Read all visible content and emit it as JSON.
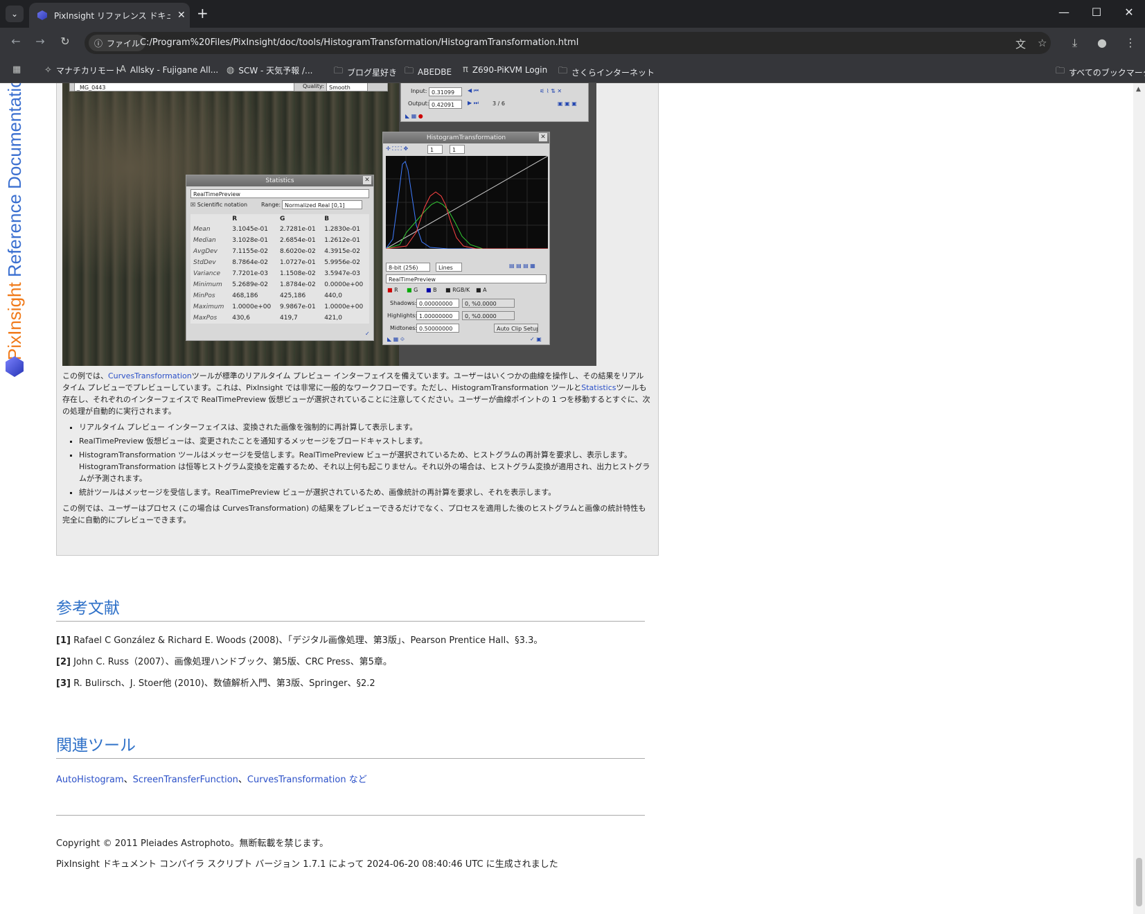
{
  "browser": {
    "tab_title": "PixInsight リファレンス ドキュメント | H",
    "site_info": "ファイル",
    "url": "C:/Program%20Files/PixInsight/doc/tools/HistogramTransformation/HistogramTransformation.html",
    "bookmarks": [
      {
        "icon": "app-icon",
        "label": "マナチカリモート"
      },
      {
        "icon": "as-icon",
        "label": "Allsky - Fujigane All..."
      },
      {
        "icon": "scw-icon",
        "label": "SCW - 天気予報 /..."
      },
      {
        "icon": "folder-icon",
        "label": "ブログ星好き"
      },
      {
        "icon": "folder-icon",
        "label": "ABEDBE"
      },
      {
        "icon": "pi-icon",
        "label": "Z690-PiKVM Login"
      },
      {
        "icon": "folder-icon",
        "label": "さくらインターネット"
      }
    ],
    "all_bookmarks": "すべてのブックマーク"
  },
  "side_banner": {
    "brand": "PixInsight",
    "docs": " Reference Documentation"
  },
  "screenshot": {
    "top_bar": {
      "image": "_MG_0443",
      "quality_label": "Quality:",
      "quality_value": "Smooth"
    },
    "curves": {
      "input_label": "Input:",
      "input_value": "0.31099",
      "output_label": "Output:",
      "output_value": "0.42091",
      "count": "3 / 6"
    },
    "stats": {
      "title": "Statistics",
      "view": "RealTimePreview",
      "sci": "Scientific notation",
      "range_label": "Range:",
      "range_value": "Normalized Real [0,1]",
      "headers": [
        "",
        "R",
        "G",
        "B"
      ],
      "rows": [
        [
          "Mean",
          "3.1045e-01",
          "2.7281e-01",
          "1.2830e-01"
        ],
        [
          "Median",
          "3.1028e-01",
          "2.6854e-01",
          "1.2612e-01"
        ],
        [
          "AvgDev",
          "7.1155e-02",
          "8.6020e-02",
          "4.3915e-02"
        ],
        [
          "StdDev",
          "8.7864e-02",
          "1.0727e-01",
          "5.9956e-02"
        ],
        [
          "Variance",
          "7.7201e-03",
          "1.1508e-02",
          "3.5947e-03"
        ],
        [
          "Minimum",
          "5.2689e-02",
          "1.8784e-02",
          "0.0000e+00"
        ],
        [
          "MinPos",
          "468,186",
          "425,186",
          "440,0"
        ],
        [
          "Maximum",
          "1.0000e+00",
          "9.9867e-01",
          "1.0000e+00"
        ],
        [
          "MaxPos",
          "430,6",
          "419,7",
          "421,0"
        ]
      ]
    },
    "hist": {
      "title": "HistogramTransformation",
      "bits": "8-bit (256)",
      "mode": "Lines",
      "view": "RealTimePreview",
      "channels": [
        "R",
        "G",
        "B",
        "RGB/K",
        "A"
      ],
      "shadows_label": "Shadows:",
      "shadows_value": "0.00000000",
      "shadows_stat": "0, %0.0000",
      "highlights_label": "Highlights:",
      "highlights_value": "1.00000000",
      "highlights_stat": "0, %0.0000",
      "midtones_label": "Midtones:",
      "midtones_value": "0.50000000",
      "auto_clip": "Auto Clip Setup",
      "zoom_h": "1",
      "zoom_v": "1"
    }
  },
  "body": {
    "p1_a": "この例では、",
    "p1_link1": "CurvesTransformation",
    "p1_b": "ツールが標準のリアルタイム プレビュー インターフェイスを備えています。ユーザーはいくつかの曲線を操作し、その結果をリアルタイム プレビューでプレビューしています。これは、PixInsight では非常に一般的なワークフローです。ただし、HistogramTransformation ツールと",
    "p1_link2": "Statistics",
    "p1_c": "ツールも存在し、それぞれのインターフェイスで RealTimePreview 仮想ビューが選択されていることに注意してください。ユーザーが曲線ポイントの 1 つを移動するとすぐに、次の処理が自動的に実行されます。",
    "bullets": [
      "リアルタイム プレビュー インターフェイスは、変換された画像を強制的に再計算して表示します。",
      "RealTimePreview 仮想ビューは、変更されたことを通知するメッセージをブロードキャストします。",
      "HistogramTransformation ツールはメッセージを受信します。RealTimePreview ビューが選択されているため、ヒストグラムの再計算を要求し、表示します。HistogramTransformation は恒等ヒストグラム変換を定義するため、それ以上何も起こりません。それ以外の場合は、ヒストグラム変換が適用され、出力ヒストグラムが予測されます。",
      "統計ツールはメッセージを受信します。RealTimePreview ビューが選択されているため、画像統計の再計算を要求し、それを表示します。"
    ],
    "p2": "この例では、ユーザーはプロセス (この場合は CurvesTransformation) の結果をプレビューできるだけでなく、プロセスを適用した後のヒストグラムと画像の統計特性も完全に自動的にプレビューできます。"
  },
  "references": {
    "heading": "参考文献",
    "items": [
      {
        "num": "[1]",
        "text": " Rafael C González & Richard E. Woods (2008)、「デジタル画像処理、第3版」、Pearson Prentice Hall、§3.3。"
      },
      {
        "num": "[2]",
        "text": " John C. Russ（2007）、画像処理ハンドブック、第5版、CRC Press、第5章。"
      },
      {
        "num": "[3]",
        "text": " R. Bulirsch、J. Stoer他 (2010)、数値解析入門、第3版、Springer、§2.2"
      }
    ]
  },
  "related": {
    "heading": "関連ツール",
    "links": [
      "AutoHistogram",
      "ScreenTransferFunction",
      "CurvesTransformation など"
    ],
    "sep": "、"
  },
  "footer": {
    "copyright": "Copyright © 2011 Pleiades Astrophoto。無断転載を禁じます。",
    "generated": "PixInsight ドキュメント コンパイラ スクリプト バージョン 1.7.1 によって 2024-06-20 08:40:46 UTC に生成されました"
  }
}
